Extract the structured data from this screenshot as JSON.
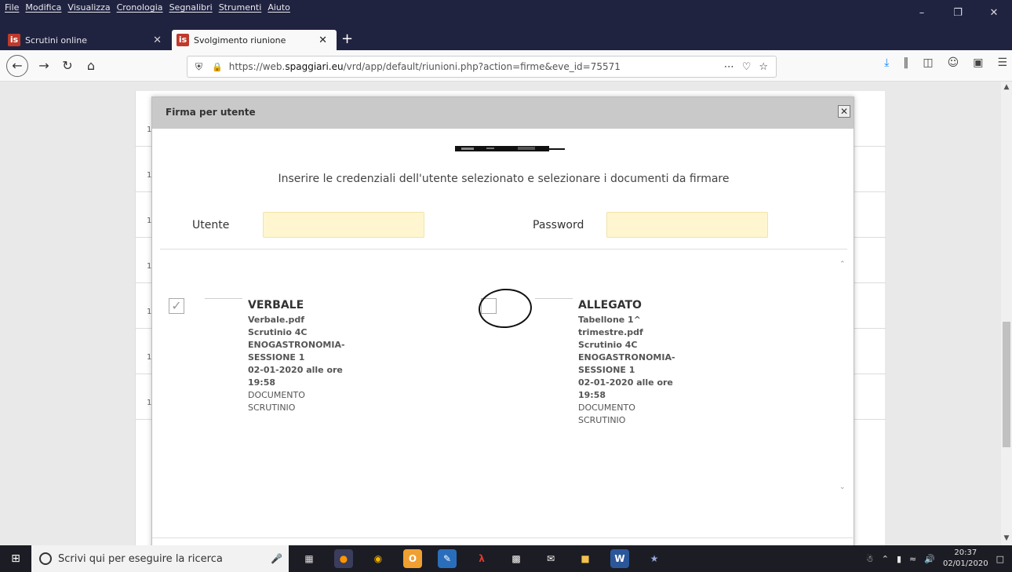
{
  "menu": [
    "File",
    "Modifica",
    "Visualizza",
    "Cronologia",
    "Segnalibri",
    "Strumenti",
    "Aiuto"
  ],
  "tabs": [
    {
      "label": "Scrutini online",
      "active": false
    },
    {
      "label": "Svolgimento riunione",
      "active": true
    }
  ],
  "url": {
    "prefix": "https://web.",
    "domain": "spaggiari.eu",
    "path": "/vrd/app/default/riunioni.php?action=firme&eve_id=75571"
  },
  "background_rows": [
    "1",
    "1",
    "1",
    "1",
    "1",
    "1",
    "1"
  ],
  "modal": {
    "title": "Firma per utente",
    "instructions": "Inserire le credenziali dell'utente selezionato e selezionare i documenti da firmare",
    "user_label": "Utente",
    "password_label": "Password",
    "user_value": "",
    "password_value": "",
    "documents": [
      {
        "type": "VERBALE",
        "file": "Verbale.pdf",
        "session": "Scrutinio 4C ENOGASTRONOMIA- SESSIONE 1",
        "date": "02-01-2020 alle ore 19:58",
        "category": "DOCUMENTO SCRUTINIO",
        "checked": true
      },
      {
        "type": "ALLEGATO",
        "file": "Tabellone 1^ trimestre.pdf",
        "session": "Scrutinio 4C ENOGASTRONOMIA- SESSIONE 1",
        "date": "02-01-2020 alle ore 19:58",
        "category": "DOCUMENTO SCRUTINIO",
        "checked": false
      }
    ]
  },
  "taskbar": {
    "search_placeholder": "Scrivi qui per eseguire la ricerca",
    "time": "20:37",
    "date": "02/01/2020"
  },
  "colors": {
    "accent": "#0a84ff",
    "field_bg": "#fff6d0",
    "modal_header": "#c9c9c9",
    "titlebar": "#202340"
  }
}
